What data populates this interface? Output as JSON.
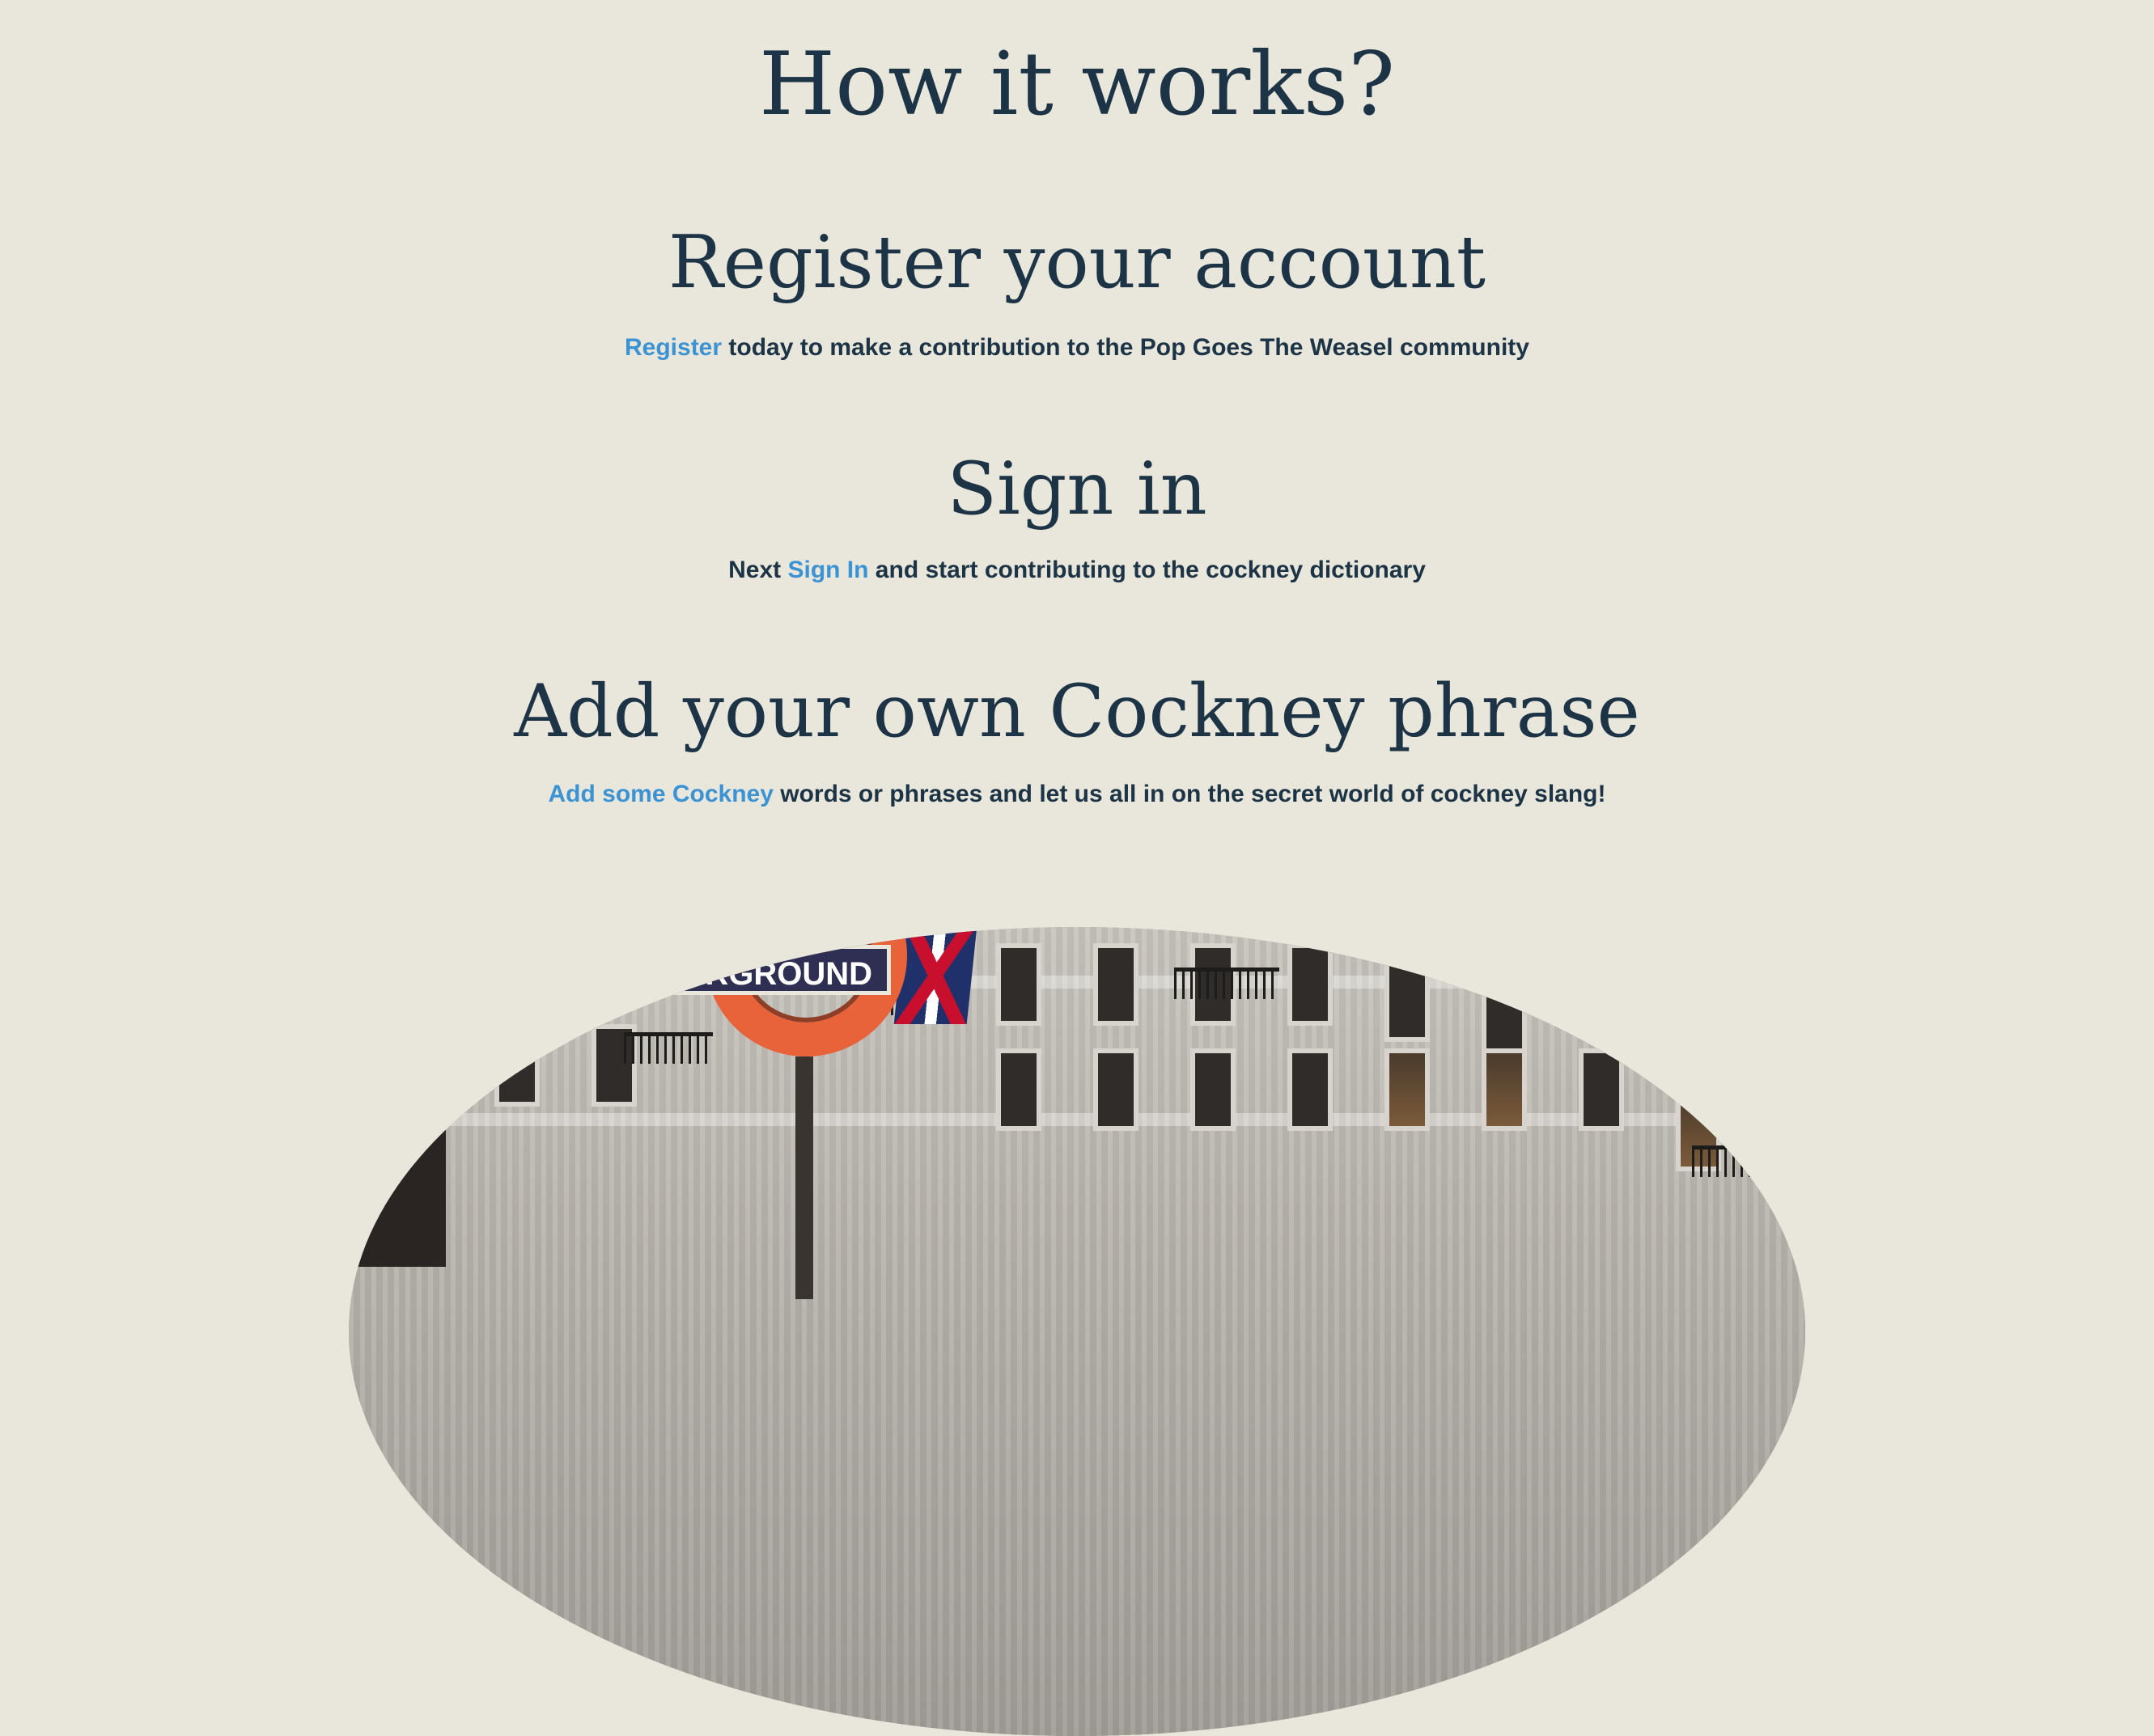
{
  "page": {
    "heading": "How it works?"
  },
  "steps": [
    {
      "title": "Register your account",
      "link_text": "Register",
      "text_after": " today to make a contribution to the Pop Goes The Weasel community"
    },
    {
      "title": "Sign in",
      "text_before": "Next ",
      "link_text": "Sign In",
      "text_after": " and start contributing to the cockney dictionary"
    },
    {
      "title": "Add your own Cockney phrase",
      "link_text": "Add some Cockney",
      "text_after": " words or phrases and let us all in on the secret world of cockney slang!"
    }
  ],
  "hero": {
    "sign_text": "ERGROUND"
  },
  "colors": {
    "background": "#E9E6DC",
    "text": "#1C3445",
    "link": "#3B93D3"
  }
}
